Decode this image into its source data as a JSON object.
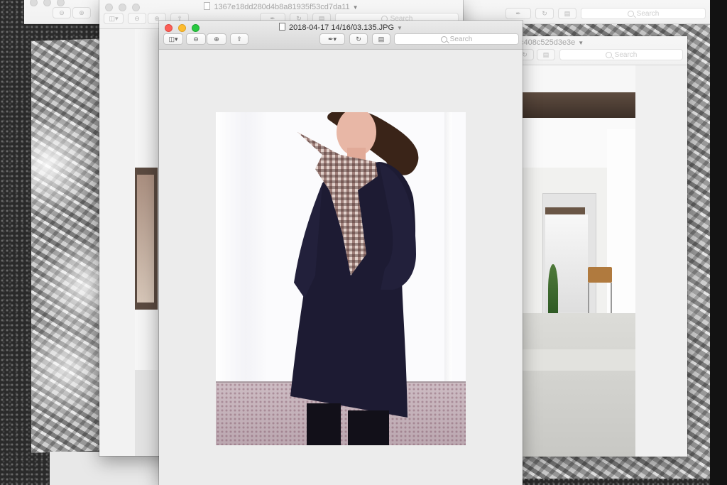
{
  "windows": {
    "back_left": {
      "title": "1367e18dd280d4b8a81935f53cd7da11",
      "search_placeholder": "Search"
    },
    "back_right": {
      "title": "c408c525d3e3e",
      "search_placeholder": "Search"
    },
    "front": {
      "title": "2018-04-17 14/16/03.135.JPG",
      "search_placeholder": "Search"
    },
    "desktop_search_placeholder": "Search"
  },
  "colors": {
    "close": "#fc5f57",
    "minimize": "#fdbc2e",
    "zoom": "#28c840"
  },
  "icons": [
    "sidebar-icon",
    "zoom-out-icon",
    "zoom-in-icon",
    "share-icon",
    "markup-pen-icon",
    "rotate-icon",
    "toolbox-icon",
    "search-icon"
  ]
}
